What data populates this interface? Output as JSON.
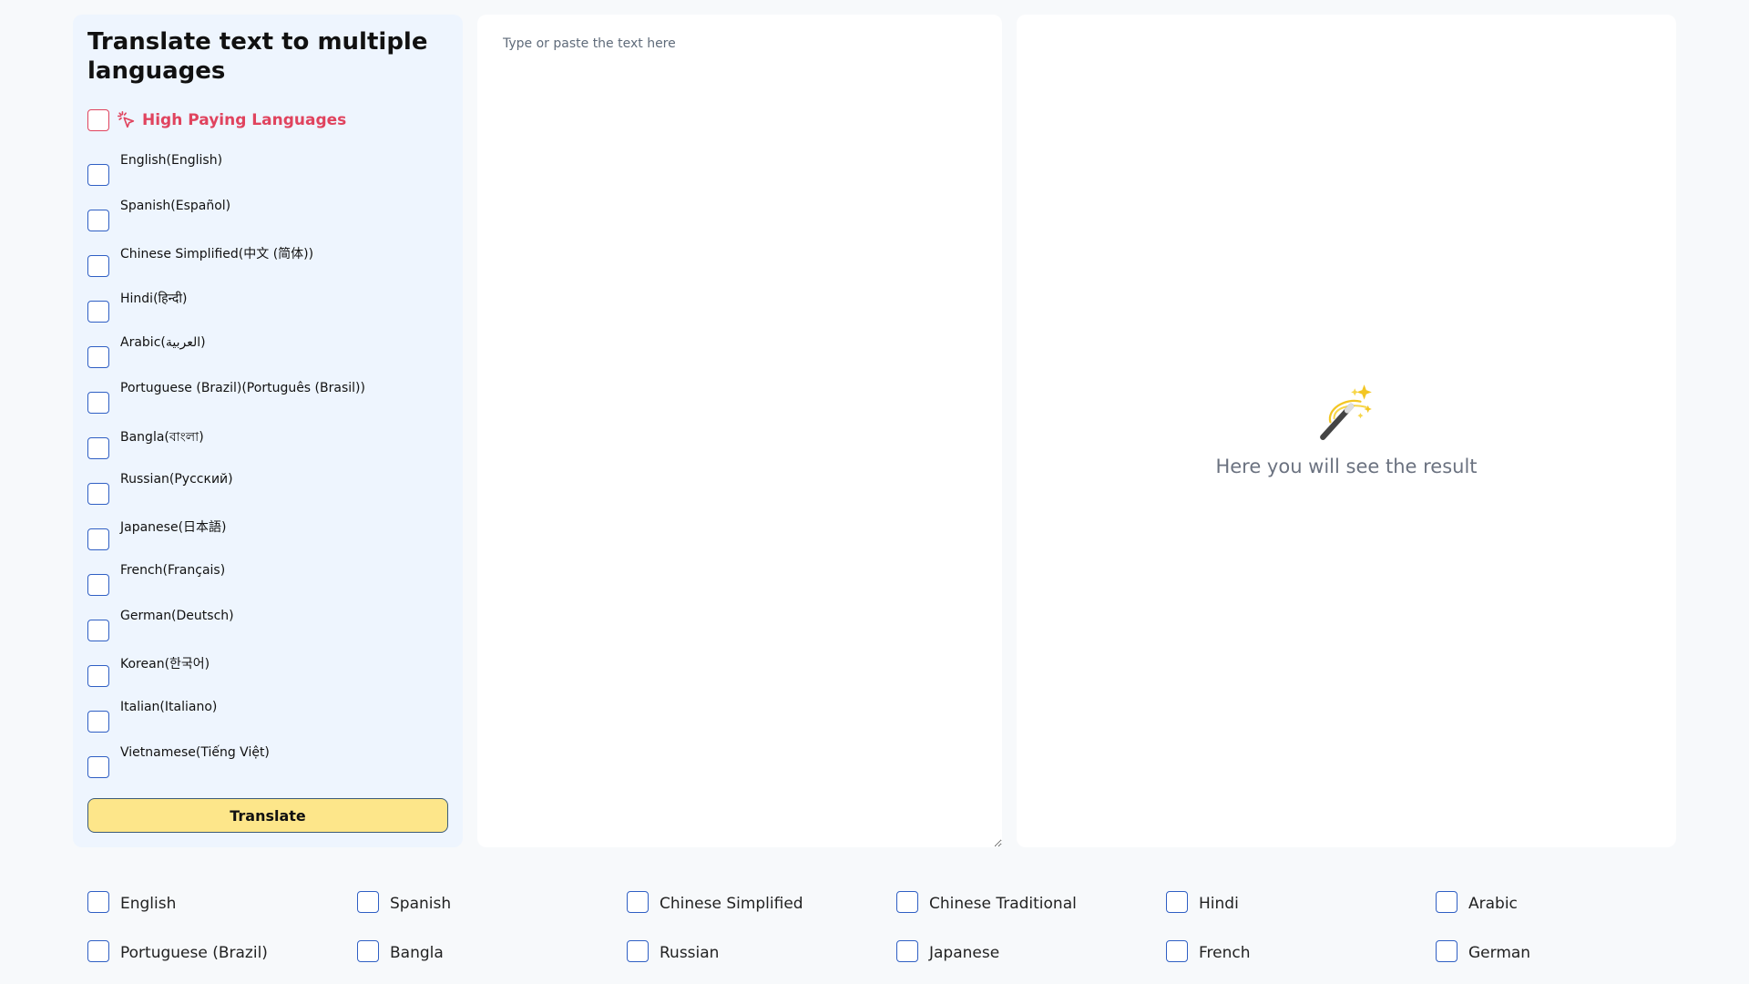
{
  "sidebar": {
    "title": "Translate text to multiple languages",
    "high_paying_label": "High Paying Languages",
    "languages": [
      "English(English)",
      "Spanish(Español)",
      "Chinese Simplified(中文 (简体))",
      "Hindi(हिन्दी)",
      "Arabic(العربية)",
      "Portuguese (Brazil)(Português (Brasil))",
      "Bangla(বাংলা)",
      "Russian(Русский)",
      "Japanese(日本語)",
      "French(Français)",
      "German(Deutsch)",
      "Korean(한국어)",
      "Italian(Italiano)",
      "Vietnamese(Tiếng Việt)"
    ],
    "translate_label": "Translate"
  },
  "input": {
    "placeholder": "Type or paste the text here",
    "value": ""
  },
  "result": {
    "placeholder_text": "Here you will see the result",
    "icon": "magic-wand-icon"
  },
  "bottom_languages": [
    "English",
    "Spanish",
    "Chinese Simplified",
    "Chinese Traditional",
    "Hindi",
    "Arabic",
    "Portuguese (Brazil)",
    "Bangla",
    "Russian",
    "Japanese",
    "French",
    "German"
  ],
  "colors": {
    "accent_red": "#e0435e",
    "checkbox_blue": "#2f5fc4",
    "button_yellow": "#fde68a",
    "sidebar_bg": "#eef5fe"
  }
}
